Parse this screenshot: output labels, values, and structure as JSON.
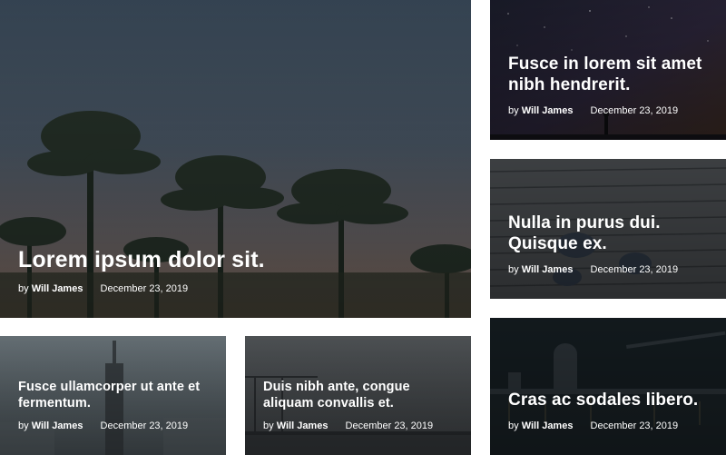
{
  "posts": [
    {
      "title": "Lorem ipsum dolor sit.",
      "by": "by",
      "author": "Will James",
      "date": "December 23, 2019"
    },
    {
      "title": "Fusce in lorem sit amet nibh hendrerit.",
      "by": "by",
      "author": "Will James",
      "date": "December 23, 2019"
    },
    {
      "title": "Nulla in purus dui. Quisque ex.",
      "by": "by",
      "author": "Will James",
      "date": "December 23, 2019"
    },
    {
      "title": "Fusce ullamcorper ut ante et fermentum.",
      "by": "by",
      "author": "Will James",
      "date": "December 23, 2019"
    },
    {
      "title": "Duis nibh ante, congue aliquam convallis et.",
      "by": "by",
      "author": "Will James",
      "date": "December 23, 2019"
    },
    {
      "title": "Cras ac sodales libero.",
      "by": "by",
      "author": "Will James",
      "date": "December 23, 2019"
    }
  ]
}
